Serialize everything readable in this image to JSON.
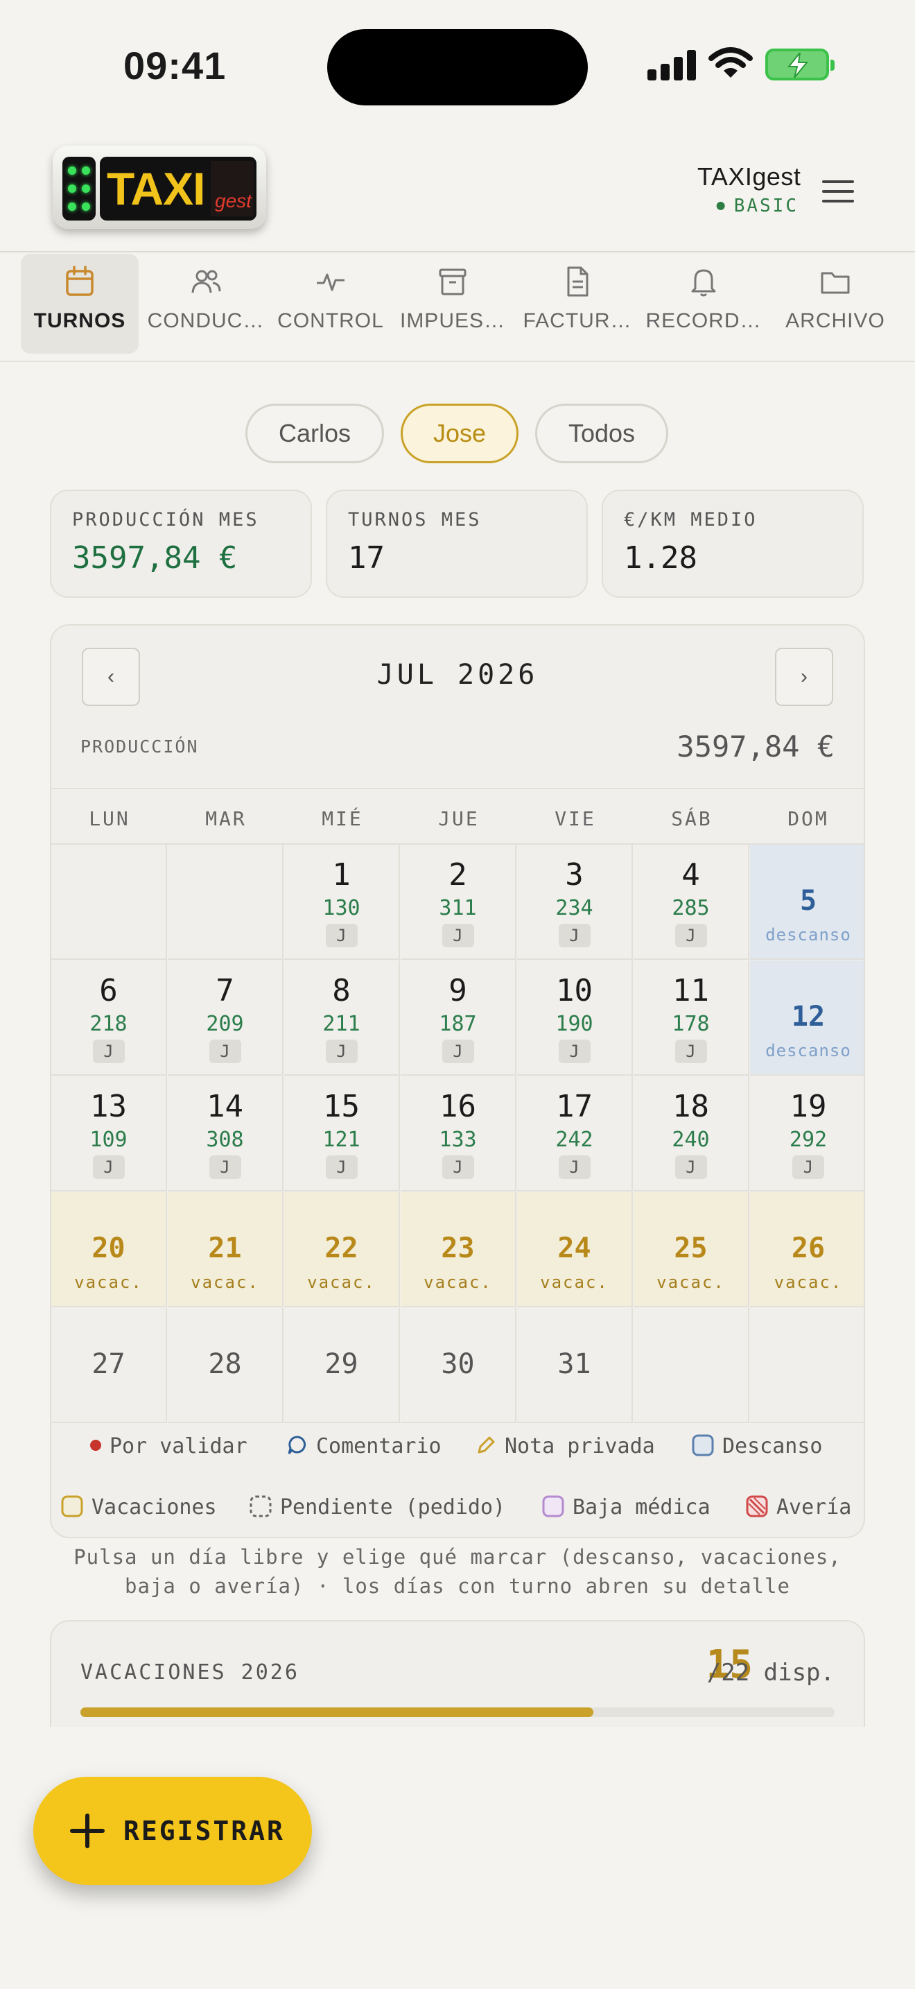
{
  "status_bar": {
    "time": "09:41"
  },
  "header": {
    "app_name": "TAXIgest",
    "plan": "BASIC",
    "logo_text": "TAXI",
    "logo_sub": "gest"
  },
  "tabs": [
    {
      "label": "TURNOS",
      "icon": "calendar-icon",
      "active": true
    },
    {
      "label": "CONDUC…",
      "icon": "users-icon"
    },
    {
      "label": "CONTROL",
      "icon": "activity-icon"
    },
    {
      "label": "IMPUES…",
      "icon": "archive-box-icon"
    },
    {
      "label": "FACTUR…",
      "icon": "document-icon"
    },
    {
      "label": "RECORD…",
      "icon": "bell-icon"
    },
    {
      "label": "ARCHIVO",
      "icon": "folder-icon"
    }
  ],
  "drivers": [
    {
      "label": "Carlos"
    },
    {
      "label": "Jose",
      "active": true
    },
    {
      "label": "Todos"
    }
  ],
  "stats": [
    {
      "label": "PRODUCCIÓN MES",
      "value": "3597,84 €"
    },
    {
      "label": "TURNOS MES",
      "value": "17"
    },
    {
      "label": "€/KM MEDIO",
      "value": "1.28"
    }
  ],
  "calendar": {
    "prev": "‹",
    "next": "›",
    "month": "JUL 2026",
    "production_label": "PRODUCCIÓN",
    "production_value": "3597,84 €",
    "weekdays": [
      "LUN",
      "MAR",
      "MIÉ",
      "JUE",
      "VIE",
      "SÁB",
      "DOM"
    ],
    "days": [
      {
        "d": "1",
        "km": "130",
        "tag": "J"
      },
      {
        "d": "2",
        "km": "311",
        "tag": "J"
      },
      {
        "d": "3",
        "km": "234",
        "tag": "J"
      },
      {
        "d": "4",
        "km": "285",
        "tag": "J"
      },
      {
        "d": "5",
        "sub": "descanso"
      },
      {
        "d": "6",
        "km": "218",
        "tag": "J"
      },
      {
        "d": "7",
        "km": "209",
        "tag": "J"
      },
      {
        "d": "8",
        "km": "211",
        "tag": "J"
      },
      {
        "d": "9",
        "km": "187",
        "tag": "J"
      },
      {
        "d": "10",
        "km": "190",
        "tag": "J"
      },
      {
        "d": "11",
        "km": "178",
        "tag": "J"
      },
      {
        "d": "12",
        "sub": "descanso"
      },
      {
        "d": "13",
        "km": "109",
        "tag": "J"
      },
      {
        "d": "14",
        "km": "308",
        "tag": "J"
      },
      {
        "d": "15",
        "km": "121",
        "tag": "J"
      },
      {
        "d": "16",
        "km": "133",
        "tag": "J"
      },
      {
        "d": "17",
        "km": "242",
        "tag": "J"
      },
      {
        "d": "18",
        "km": "240",
        "tag": "J"
      },
      {
        "d": "19",
        "km": "292",
        "tag": "J"
      },
      {
        "d": "20",
        "sub": "vacac."
      },
      {
        "d": "21",
        "sub": "vacac."
      },
      {
        "d": "22",
        "sub": "vacac."
      },
      {
        "d": "23",
        "sub": "vacac."
      },
      {
        "d": "24",
        "sub": "vacac."
      },
      {
        "d": "25",
        "sub": "vacac."
      },
      {
        "d": "26",
        "sub": "vacac."
      },
      {
        "d": "27"
      },
      {
        "d": "28"
      },
      {
        "d": "29"
      },
      {
        "d": "30"
      },
      {
        "d": "31"
      }
    ],
    "legend": [
      {
        "label": "Por validar",
        "color": "#c6342b"
      },
      {
        "label": "Comentario",
        "color": "#2f5f99"
      },
      {
        "label": "Nota privada",
        "color": "#c9a12b"
      },
      {
        "label": "Descanso",
        "color": "#5b7fae"
      },
      {
        "label": "Vacaciones",
        "color": "#c9a12b"
      },
      {
        "label": "Pendiente (pedido)",
        "color": "#666666"
      },
      {
        "label": "Baja médica",
        "color": "#b48ad0"
      },
      {
        "label": "Avería",
        "color": "#d04a4a"
      }
    ]
  },
  "hint": "Pulsa un día libre y elige qué marcar (descanso, vacaciones, baja o avería) · los días con turno abren su detalle",
  "vacations": {
    "label": "VACACIONES 2026",
    "available": "15",
    "total": "/22 disp.",
    "used_fraction": 0.68
  },
  "fab": {
    "label": "REGISTRAR"
  },
  "colors": {
    "accent": "#f4c51a",
    "green": "#1f7040",
    "rest": "#e0e7ef",
    "vacation": "#f3eed9"
  }
}
